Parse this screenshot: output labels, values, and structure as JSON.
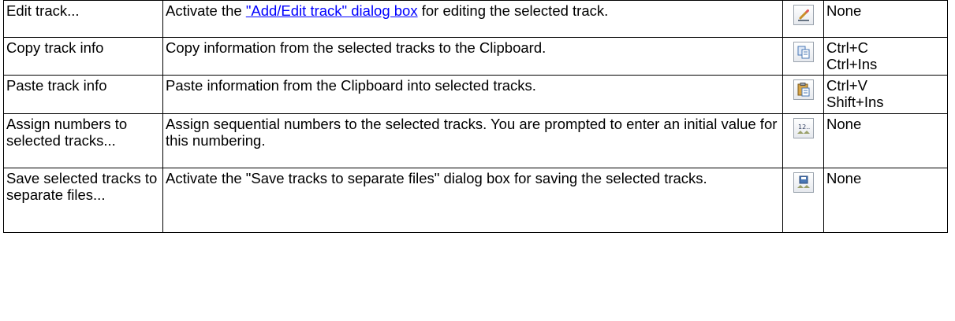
{
  "rows": [
    {
      "command": "Edit track...",
      "desc_pre": "Activate the ",
      "desc_link": "\"Add/Edit track\" dialog box",
      "desc_post": " for editing the selected track.",
      "icon": "edit-pencil-icon",
      "shortcuts": [
        "None"
      ]
    },
    {
      "command": "Copy track info",
      "desc": "Copy information from the selected tracks to the Clipboard.",
      "icon": "copy-icon",
      "shortcuts": [
        "Ctrl+C",
        "Ctrl+Ins"
      ]
    },
    {
      "command": "Paste track info",
      "desc": "Paste information from the Clipboard into selected tracks.",
      "icon": "paste-clipboard-icon",
      "shortcuts": [
        "Ctrl+V",
        "Shift+Ins"
      ]
    },
    {
      "command": "Assign numbers to selected tracks...",
      "desc": "Assign sequential numbers to the selected tracks. You are prompted to enter an initial value for this numbering.",
      "icon": "numbering-icon",
      "shortcuts": [
        "None"
      ]
    },
    {
      "command": "Save selected tracks to separate files...",
      "desc": "Activate the \"Save tracks to separate files\" dialog box for saving the selected tracks.",
      "icon": "save-disk-icon",
      "shortcuts": [
        "None"
      ]
    }
  ],
  "colors": {
    "link": "#0000ff",
    "border": "#000000"
  }
}
